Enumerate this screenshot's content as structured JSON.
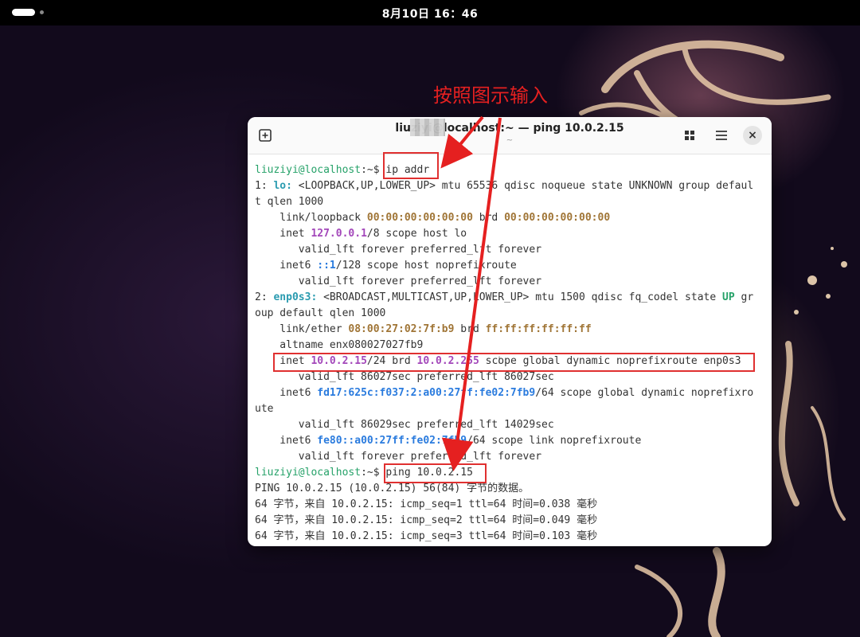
{
  "topbar": {
    "clock": "8月10日 16：46"
  },
  "terminal": {
    "title": "liuziyi@localhost:~ — ping 10.0.2.15",
    "subtitle": "~",
    "close_icon": "×",
    "lines": [
      [
        {
          "t": "liuziyi@localhost",
          "c": "prompt"
        },
        {
          "t": ":~$ "
        },
        {
          "t": "ip addr"
        }
      ],
      [
        {
          "t": "1: "
        },
        {
          "t": "lo:",
          "c": "c-bold-teal"
        },
        {
          "t": " <LOOPBACK,UP,LOWER_UP> mtu 65536 qdisc noqueue state UNKNOWN group defaul"
        }
      ],
      [
        {
          "t": "t qlen 1000"
        }
      ],
      [
        {
          "t": "    link/loopback "
        },
        {
          "t": "00:00:00:00:00:00",
          "c": "c-mac"
        },
        {
          "t": " brd "
        },
        {
          "t": "00:00:00:00:00:00",
          "c": "c-mac"
        }
      ],
      [
        {
          "t": "    inet "
        },
        {
          "t": "127.0.0.1",
          "c": "c-ip4"
        },
        {
          "t": "/8 scope host lo"
        }
      ],
      [
        {
          "t": "       valid_lft forever preferred_lft forever"
        }
      ],
      [
        {
          "t": "    inet6 "
        },
        {
          "t": "::1",
          "c": "c-ip6"
        },
        {
          "t": "/128 scope host noprefixroute"
        }
      ],
      [
        {
          "t": "       valid_lft forever preferred_lft forever"
        }
      ],
      [
        {
          "t": "2: "
        },
        {
          "t": "enp0s3:",
          "c": "c-bold-teal"
        },
        {
          "t": " <BROADCAST,MULTICAST,UP,LOWER_UP> mtu 1500 qdisc fq_codel state "
        },
        {
          "t": "UP",
          "c": "c-up"
        },
        {
          "t": " gr"
        }
      ],
      [
        {
          "t": "oup default qlen 1000"
        }
      ],
      [
        {
          "t": "    link/ether "
        },
        {
          "t": "08:00:27:02:7f:b9",
          "c": "c-mac"
        },
        {
          "t": " brd "
        },
        {
          "t": "ff:ff:ff:ff:ff:ff",
          "c": "c-mac"
        }
      ],
      [
        {
          "t": "    altname enx080027027fb9"
        }
      ],
      [
        {
          "t": "    inet "
        },
        {
          "t": "10.0.2.15",
          "c": "c-ip4"
        },
        {
          "t": "/24 brd "
        },
        {
          "t": "10.0.2.255",
          "c": "c-ip4"
        },
        {
          "t": " scope global dynamic noprefixroute enp0s3"
        }
      ],
      [
        {
          "t": "       valid_lft 86027sec preferred_lft 86027sec"
        }
      ],
      [
        {
          "t": "    inet6 "
        },
        {
          "t": "fd17:625c:f037:2:a00:27ff:fe02:7fb9",
          "c": "c-ip6"
        },
        {
          "t": "/64 scope global dynamic noprefixro"
        }
      ],
      [
        {
          "t": "ute"
        }
      ],
      [
        {
          "t": "       valid_lft 86029sec preferred_lft 14029sec"
        }
      ],
      [
        {
          "t": "    inet6 "
        },
        {
          "t": "fe80::a00:27ff:fe02:7fb9",
          "c": "c-ip6"
        },
        {
          "t": "/64 scope link noprefixroute"
        }
      ],
      [
        {
          "t": "       valid_lft forever preferred_lft forever"
        }
      ],
      [
        {
          "t": "liuziyi@localhost",
          "c": "prompt"
        },
        {
          "t": ":~$ "
        },
        {
          "t": "ping 10.0.2.15"
        }
      ],
      [
        {
          "t": "PING 10.0.2.15 (10.0.2.15) 56(84) 字节的数据。"
        }
      ],
      [
        {
          "t": "64 字节，来自 10.0.2.15: icmp_seq=1 ttl=64 时间=0.038 毫秒"
        }
      ],
      [
        {
          "t": "64 字节，来自 10.0.2.15: icmp_seq=2 ttl=64 时间=0.049 毫秒"
        }
      ],
      [
        {
          "t": "64 字节，来自 10.0.2.15: icmp_seq=3 ttl=64 时间=0.103 毫秒"
        }
      ]
    ]
  },
  "annotation": {
    "label": "按照图示输入",
    "color": "#e52020"
  },
  "icons": {
    "new_tab": "new-tab-icon",
    "tabs": "tabs-grid-icon",
    "menu": "hamburger-menu-icon",
    "close": "close-icon"
  }
}
